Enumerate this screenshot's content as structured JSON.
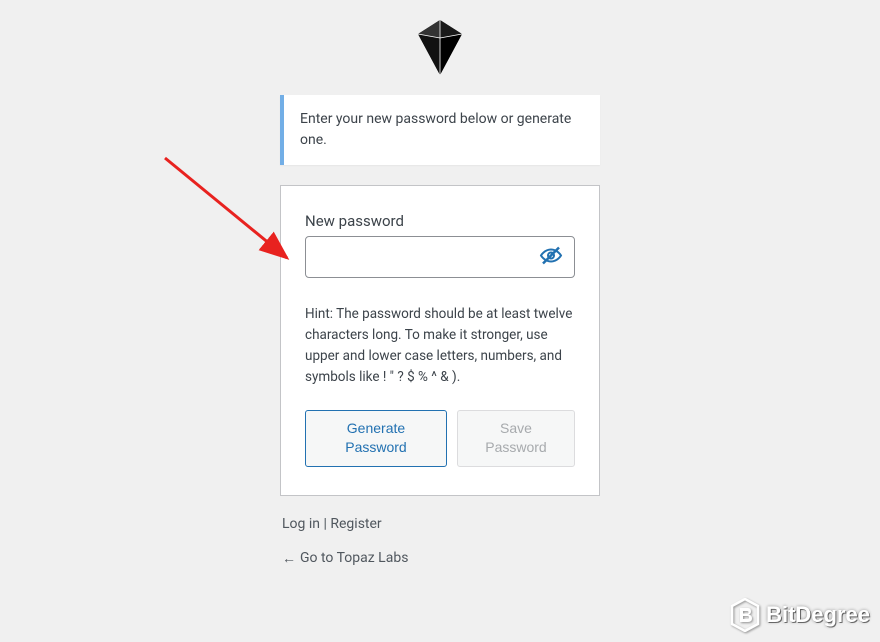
{
  "message": "Enter your new password below or generate one.",
  "form": {
    "password_label": "New password",
    "password_value": "",
    "hint": "Hint: The password should be at least twelve characters long. To make it stronger, use upper and lower case letters, numbers, and symbols like ! \" ? $ % ^ & ).",
    "generate_button": "Generate Password",
    "save_button": "Save Password"
  },
  "nav": {
    "login": "Log in",
    "separator": " | ",
    "register": "Register",
    "back_arrow": "←",
    "back_text": "Go to Topaz Labs"
  },
  "watermark": "BitDegree"
}
